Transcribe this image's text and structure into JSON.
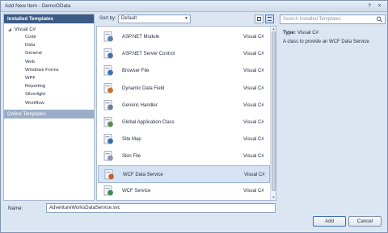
{
  "window": {
    "title": "Add New Item - DemoOData",
    "help_label": "?",
    "close_label": "×"
  },
  "left_panel": {
    "installed_header": "Installed Templates",
    "root_label": "Visual C#",
    "children": [
      "Code",
      "Data",
      "General",
      "Web",
      "Windows Forms",
      "WPF",
      "Reporting",
      "Silverlight",
      "Workflow"
    ],
    "online_header": "Online Templates"
  },
  "toolbar": {
    "sort_label": "Sort by:",
    "sort_value": "Default"
  },
  "search": {
    "placeholder": "Search Installed Templates"
  },
  "items": [
    {
      "name": "ASP.NET Module",
      "lang": "Visual C#",
      "icon": "module-icon",
      "color": "#5a7fb5"
    },
    {
      "name": "ASP.NET Server Control",
      "lang": "Visual C#",
      "icon": "server-control-icon",
      "color": "#4b6ea5"
    },
    {
      "name": "Browser File",
      "lang": "Visual C#",
      "icon": "browser-file-icon",
      "color": "#3b6fb8"
    },
    {
      "name": "Dynamic Data Field",
      "lang": "Visual C#",
      "icon": "dynamic-data-icon",
      "color": "#c8732a"
    },
    {
      "name": "Generic Handler",
      "lang": "Visual C#",
      "icon": "handler-icon",
      "color": "#6a7d98"
    },
    {
      "name": "Global Application Class",
      "lang": "Visual C#",
      "icon": "global-class-icon",
      "color": "#5a8a4a"
    },
    {
      "name": "Site Map",
      "lang": "Visual C#",
      "icon": "site-map-icon",
      "color": "#3a6aa8"
    },
    {
      "name": "Skin File",
      "lang": "Visual C#",
      "icon": "skin-file-icon",
      "color": "#8a94a6"
    },
    {
      "name": "WCF Data Service",
      "lang": "Visual C#",
      "icon": "wcf-data-service-icon",
      "color": "#c0642a"
    },
    {
      "name": "WCF Service",
      "lang": "Visual C#",
      "icon": "wcf-service-icon",
      "color": "#3e8a4e"
    }
  ],
  "selected_index": 8,
  "details": {
    "type_label": "Type:",
    "type_value": "Visual C#",
    "description": "A class to provide an WCF Data Service"
  },
  "bottom": {
    "name_label": "Name:",
    "name_value": "AdventureWorksDataService.svc",
    "add_label": "Add",
    "cancel_label": "Cancel"
  },
  "colors": {
    "header_blue": "#3c5a86",
    "selection": "#d6e3f4"
  }
}
